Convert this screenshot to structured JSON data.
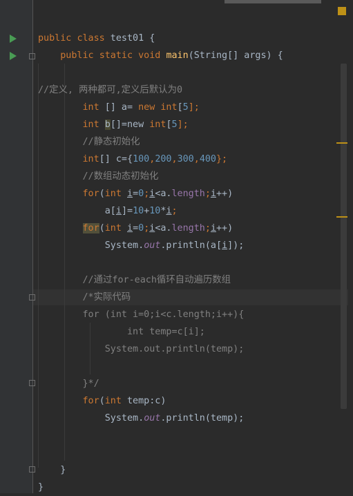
{
  "editor": {
    "lines": [
      {
        "segments": [
          {
            "t": "public",
            "c": "kw"
          },
          {
            "t": " "
          },
          {
            "t": "class",
            "c": "kw"
          },
          {
            "t": " test01 {"
          }
        ]
      },
      {
        "segments": [
          {
            "t": "    "
          },
          {
            "t": "public",
            "c": "kw"
          },
          {
            "t": " "
          },
          {
            "t": "static",
            "c": "kw"
          },
          {
            "t": " "
          },
          {
            "t": "void",
            "c": "kw"
          },
          {
            "t": " "
          },
          {
            "t": "main",
            "c": "fn"
          },
          {
            "t": "(String[] args) {"
          }
        ]
      },
      {
        "segments": [
          {
            "t": ""
          }
        ]
      },
      {
        "segments": [
          {
            "t": "//定义, 两种都可,定义后默认为0",
            "c": "cmt"
          }
        ]
      },
      {
        "segments": [
          {
            "t": "        "
          },
          {
            "t": "int",
            "c": "kw"
          },
          {
            "t": " [] a= "
          },
          {
            "t": "new",
            "c": "kw"
          },
          {
            "t": " "
          },
          {
            "t": "int",
            "c": "kw"
          },
          {
            "t": "["
          },
          {
            "t": "5",
            "c": "num"
          },
          {
            "t": "];",
            "c": "kw"
          }
        ]
      },
      {
        "segments": [
          {
            "t": "        "
          },
          {
            "t": "int",
            "c": "kw"
          },
          {
            "t": " "
          },
          {
            "t": "b",
            "c": "hl"
          },
          {
            "t": "[]=new "
          },
          {
            "t": "int",
            "c": "kw"
          },
          {
            "t": "["
          },
          {
            "t": "5",
            "c": "num"
          },
          {
            "t": "];",
            "c": "kw"
          }
        ]
      },
      {
        "segments": [
          {
            "t": "        "
          },
          {
            "t": "//静态初始化",
            "c": "cmt"
          }
        ]
      },
      {
        "segments": [
          {
            "t": "        "
          },
          {
            "t": "int",
            "c": "kw"
          },
          {
            "t": "[] c={"
          },
          {
            "t": "100",
            "c": "num"
          },
          {
            "t": ",",
            "c": "kw"
          },
          {
            "t": "200",
            "c": "num"
          },
          {
            "t": ",",
            "c": "kw"
          },
          {
            "t": "300",
            "c": "num"
          },
          {
            "t": ",",
            "c": "kw"
          },
          {
            "t": "400",
            "c": "num"
          },
          {
            "t": "};",
            "c": "kw"
          }
        ]
      },
      {
        "segments": [
          {
            "t": "        "
          },
          {
            "t": "//数组动态初始化",
            "c": "cmt"
          }
        ]
      },
      {
        "segments": [
          {
            "t": "        "
          },
          {
            "t": "for",
            "c": "kw"
          },
          {
            "t": "("
          },
          {
            "t": "int",
            "c": "kw"
          },
          {
            "t": " "
          },
          {
            "t": "i",
            "c": "u"
          },
          {
            "t": "="
          },
          {
            "t": "0",
            "c": "num"
          },
          {
            "t": ";",
            "c": "kw"
          },
          {
            "t": "i",
            "c": "u"
          },
          {
            "t": "<a."
          },
          {
            "t": "length",
            "c": "field"
          },
          {
            "t": ";",
            "c": "kw"
          },
          {
            "t": "i",
            "c": "u"
          },
          {
            "t": "++)"
          }
        ]
      },
      {
        "segments": [
          {
            "t": "            a["
          },
          {
            "t": "i",
            "c": "u"
          },
          {
            "t": "]="
          },
          {
            "t": "10",
            "c": "num"
          },
          {
            "t": "+"
          },
          {
            "t": "10",
            "c": "num"
          },
          {
            "t": "*"
          },
          {
            "t": "i",
            "c": "u"
          },
          {
            "t": ";",
            "c": "kw"
          }
        ]
      },
      {
        "segments": [
          {
            "t": "        "
          },
          {
            "t": "for",
            "c": "kw hl2"
          },
          {
            "t": "("
          },
          {
            "t": "int",
            "c": "kw"
          },
          {
            "t": " "
          },
          {
            "t": "i",
            "c": "u"
          },
          {
            "t": "="
          },
          {
            "t": "0",
            "c": "num"
          },
          {
            "t": ";",
            "c": "kw"
          },
          {
            "t": "i",
            "c": "u"
          },
          {
            "t": "<a."
          },
          {
            "t": "length",
            "c": "field"
          },
          {
            "t": ";",
            "c": "kw"
          },
          {
            "t": "i",
            "c": "u"
          },
          {
            "t": "++)"
          }
        ]
      },
      {
        "segments": [
          {
            "t": "            System."
          },
          {
            "t": "out",
            "c": "ital-field"
          },
          {
            "t": ".println(a["
          },
          {
            "t": "i",
            "c": "u"
          },
          {
            "t": "]);"
          }
        ]
      },
      {
        "segments": [
          {
            "t": ""
          }
        ]
      },
      {
        "segments": [
          {
            "t": "        "
          },
          {
            "t": "//通过for-each循环自动遍历数组",
            "c": "cmt"
          }
        ]
      },
      {
        "segments": [
          {
            "t": "        "
          },
          {
            "t": "/*实际代码",
            "c": "cmt"
          }
        ]
      },
      {
        "segments": [
          {
            "t": "        "
          },
          {
            "t": "for (int i=0;i<c.length;i++){",
            "c": "cmt"
          }
        ]
      },
      {
        "segments": [
          {
            "t": "                "
          },
          {
            "t": "int temp=c[i];",
            "c": "cmt"
          }
        ]
      },
      {
        "segments": [
          {
            "t": "            "
          },
          {
            "t": "System.out.println(temp);",
            "c": "cmt"
          }
        ]
      },
      {
        "segments": [
          {
            "t": ""
          }
        ]
      },
      {
        "segments": [
          {
            "t": "        "
          },
          {
            "t": "}*/",
            "c": "cmt"
          }
        ]
      },
      {
        "segments": [
          {
            "t": "        "
          },
          {
            "t": "for",
            "c": "kw"
          },
          {
            "t": "("
          },
          {
            "t": "int",
            "c": "kw"
          },
          {
            "t": " temp:c)"
          }
        ]
      },
      {
        "segments": [
          {
            "t": "            System."
          },
          {
            "t": "out",
            "c": "ital-field"
          },
          {
            "t": ".println(temp);"
          }
        ]
      },
      {
        "segments": [
          {
            "t": ""
          }
        ]
      },
      {
        "segments": [
          {
            "t": ""
          }
        ]
      },
      {
        "segments": [
          {
            "t": "    }"
          }
        ]
      },
      {
        "segments": [
          {
            "t": "}"
          }
        ]
      }
    ]
  },
  "gutter": {
    "run_icons": [
      "run-class",
      "run-main"
    ],
    "fold_icons": [
      "fold-main",
      "fold-comment",
      "fold-comment-end",
      "fold-main-end"
    ]
  }
}
